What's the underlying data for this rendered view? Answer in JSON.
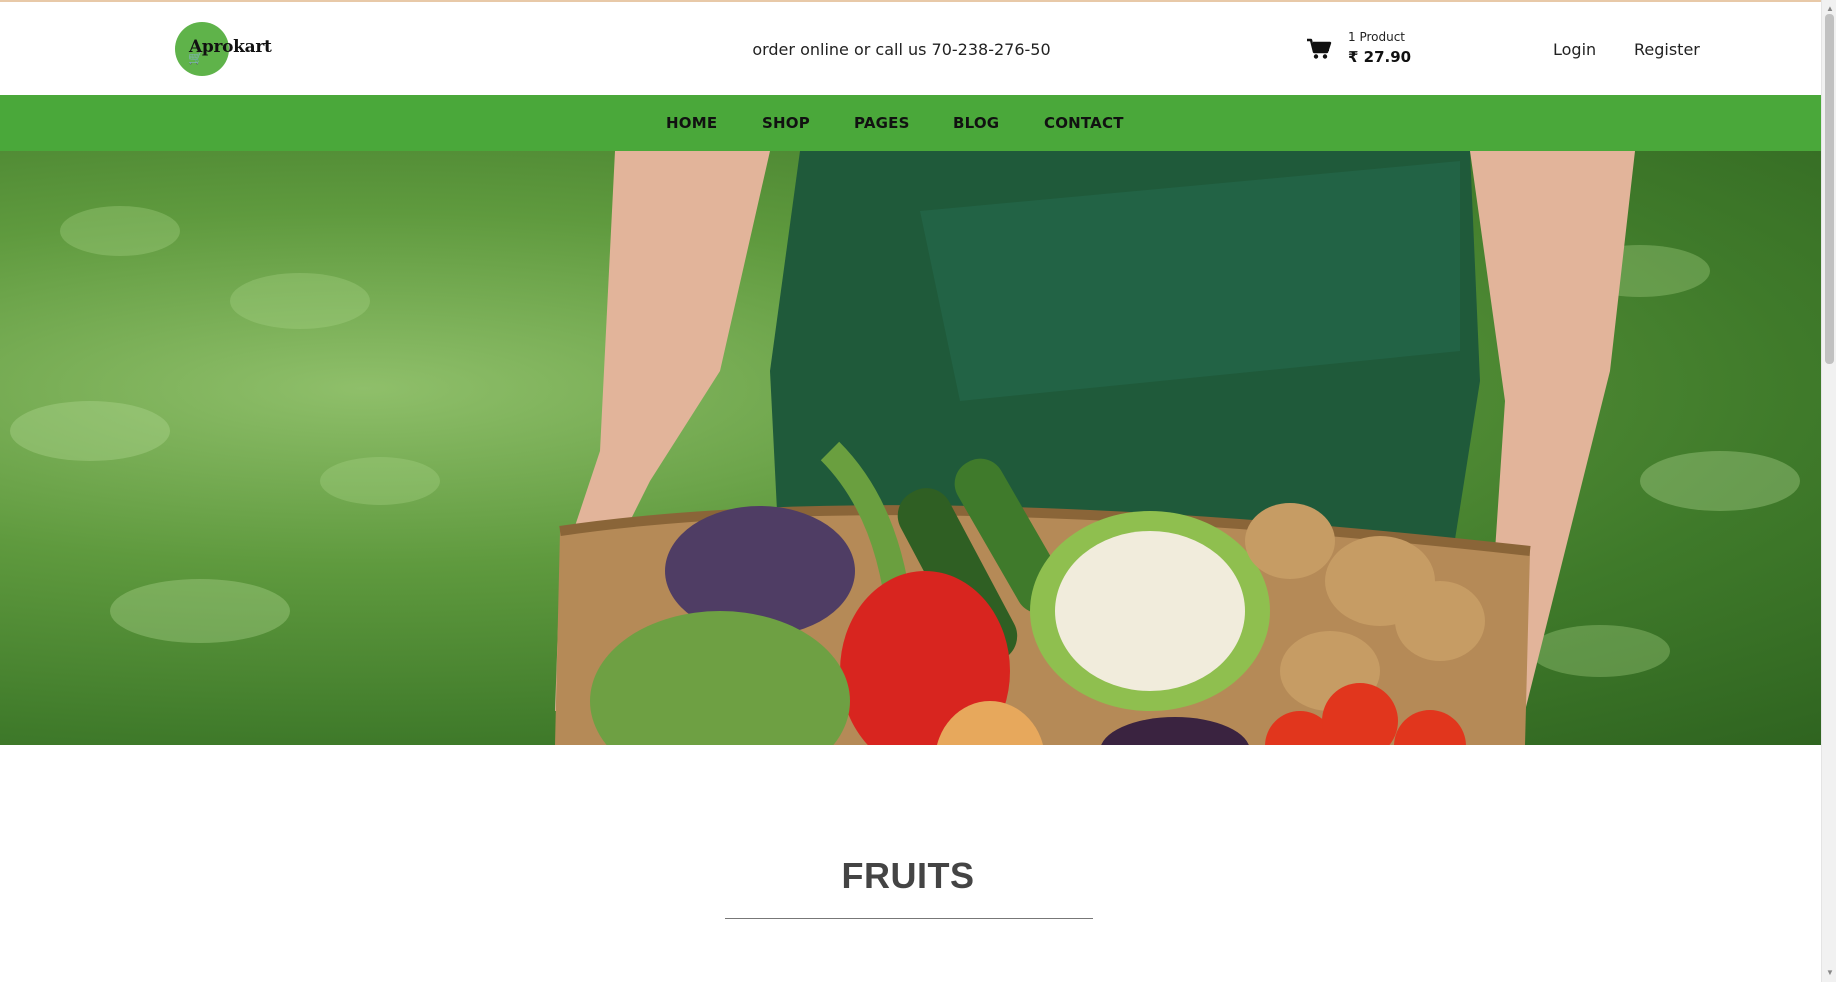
{
  "brand": {
    "name": "Aprokart"
  },
  "header": {
    "contact_text": "order online or call us 70-238-276-50",
    "cart": {
      "count_label": "1 Product",
      "total": "₹ 27.90"
    },
    "login_label": "Login",
    "register_label": "Register"
  },
  "nav": {
    "items": [
      {
        "label": "HOME"
      },
      {
        "label": "SHOP"
      },
      {
        "label": "PAGES"
      },
      {
        "label": "BLOG"
      },
      {
        "label": "CONTACT"
      }
    ]
  },
  "section": {
    "title": "FRUITS"
  },
  "colors": {
    "nav_green": "#4aa83a",
    "logo_green": "#5fb34a"
  },
  "icons": {
    "cart": "shopping-cart-icon",
    "logo_cart": "cart-icon"
  }
}
